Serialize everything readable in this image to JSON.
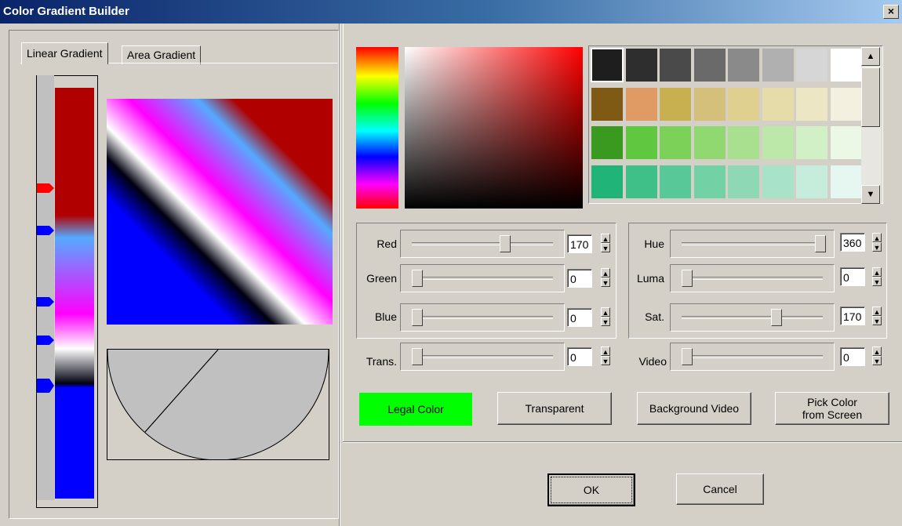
{
  "window": {
    "title": "Color Gradient Builder",
    "close_glyph": "×"
  },
  "tabs": [
    {
      "label": "Linear Gradient"
    },
    {
      "label": "Area Gradient"
    }
  ],
  "gradient": {
    "stop_colors": [
      "#ff0000",
      "#0000ff",
      "#0000ff",
      "#0000ff",
      "#0000ff"
    ],
    "colors": [
      "#b00000",
      "#55aaff",
      "#ff00ff",
      "#ffffff",
      "#000010",
      "#0000ff"
    ],
    "angle_icon": "angle-dial"
  },
  "palette": {
    "rows": [
      [
        "#1e1e1e",
        "#2e2e2e",
        "#4a4a4a",
        "#6a6a6a",
        "#8a8a8a",
        "#b0b0b0",
        "#d6d6d6",
        "#ffffff"
      ],
      [
        "#7e5a14",
        "#e09a64",
        "#c8b050",
        "#d4c07a",
        "#e0d090",
        "#e6dcaa",
        "#ece6c4",
        "#f4f0e0"
      ],
      [
        "#3a9a20",
        "#60c840",
        "#7cd258",
        "#90d870",
        "#a8e090",
        "#bce8aa",
        "#d2f0c6",
        "#ecf8e6"
      ],
      [
        "#20b478",
        "#3ec088",
        "#58c898",
        "#72d2a6",
        "#8ed8b6",
        "#a8e2c8",
        "#c6ecdc",
        "#e6f6f0"
      ]
    ],
    "scroll_up": "▲",
    "scroll_down": "▼"
  },
  "rgb": {
    "red": {
      "label": "Red",
      "value": "170"
    },
    "green": {
      "label": "Green",
      "value": "0"
    },
    "blue": {
      "label": "Blue",
      "value": "0"
    }
  },
  "hls": {
    "hue": {
      "label": "Hue",
      "value": "360"
    },
    "luma": {
      "label": "Luma",
      "value": "0"
    },
    "sat": {
      "label": "Sat.",
      "value": "170"
    }
  },
  "trans": {
    "label": "Trans.",
    "value": "0"
  },
  "video": {
    "label": "Video",
    "value": "0"
  },
  "spin": {
    "up": "▲",
    "down": "▼"
  },
  "buttons": {
    "legal": "Legal Color",
    "transparent": "Transparent",
    "background_video": "Background Video",
    "pick_line1": "Pick Color",
    "pick_line2": "from Screen",
    "ok": "OK",
    "cancel": "Cancel"
  }
}
